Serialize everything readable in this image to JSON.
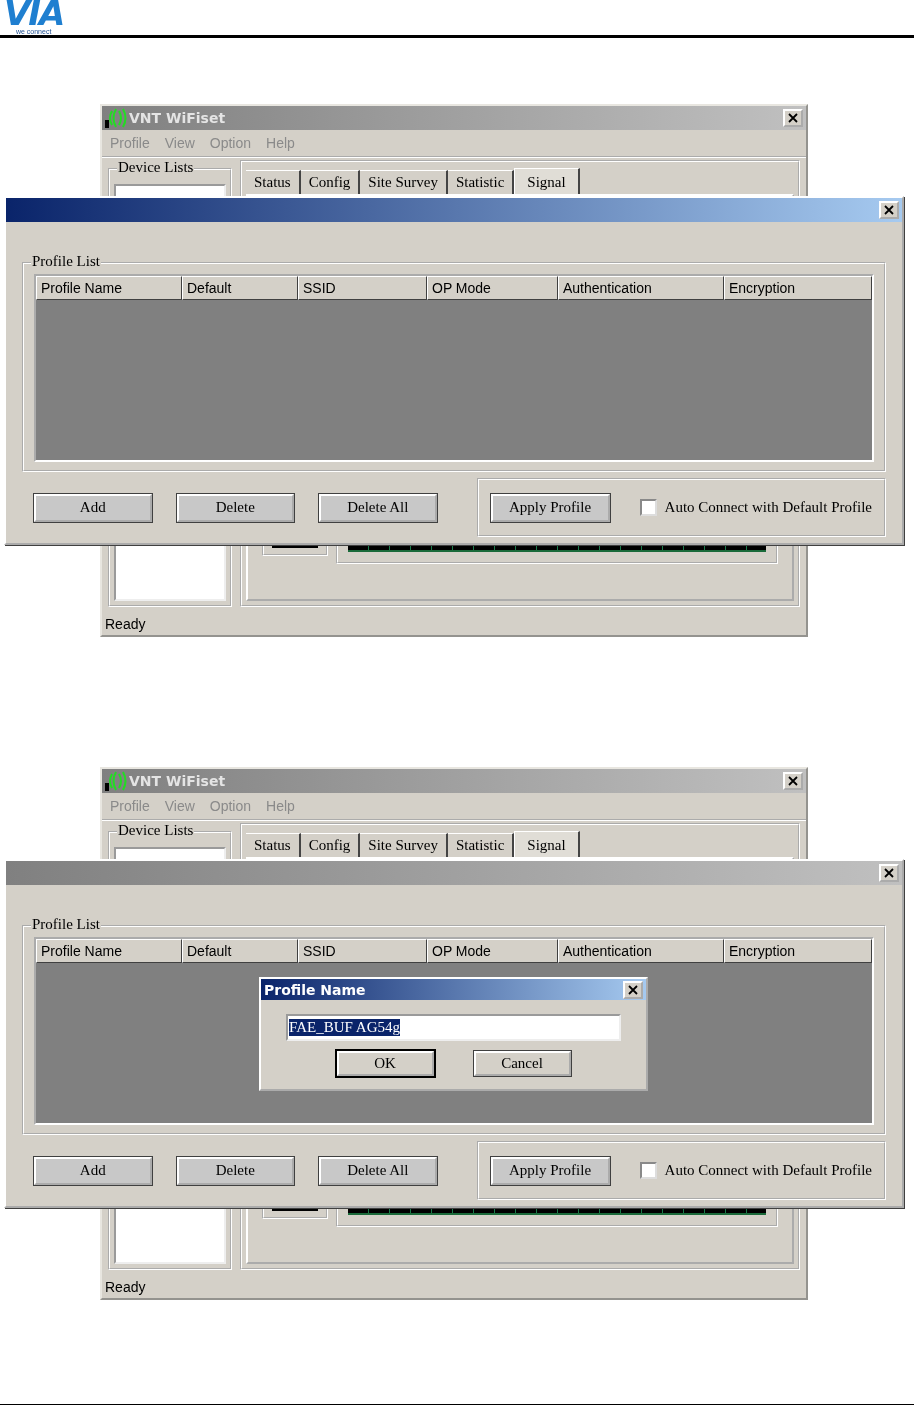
{
  "header": {
    "logo": "VIA",
    "tagline": "we connect"
  },
  "screenshots": [
    {
      "main_window": {
        "title": "VNT WiFiset",
        "menu": [
          {
            "label": "Profile",
            "disabled": true
          },
          {
            "label": "View",
            "disabled": true
          },
          {
            "label": "Option",
            "disabled": true
          },
          {
            "label": "Help",
            "disabled": true
          }
        ],
        "device_lists_label": "Device Lists",
        "tabs": [
          {
            "label": "Status",
            "selected": false
          },
          {
            "label": "Config",
            "selected": false
          },
          {
            "label": "Site Survey",
            "selected": false
          },
          {
            "label": "Statistic",
            "selected": false
          },
          {
            "label": "Signal",
            "selected": true
          }
        ],
        "status": "Ready"
      },
      "dialog": {
        "active": true,
        "group_label": "Profile List",
        "columns": [
          "Profile Name",
          "Default",
          "SSID",
          "OP Mode",
          "Authentication",
          "Encryption"
        ],
        "buttons": [
          "Add",
          "Delete",
          "Delete All"
        ],
        "apply_button": "Apply Profile",
        "auto_connect": {
          "label": "Auto Connect with Default Profile",
          "checked": false
        }
      }
    },
    {
      "main_window": {
        "title": "VNT WiFiset",
        "menu": [
          {
            "label": "Profile",
            "disabled": true
          },
          {
            "label": "View",
            "disabled": true
          },
          {
            "label": "Option",
            "disabled": true
          },
          {
            "label": "Help",
            "disabled": true
          }
        ],
        "device_lists_label": "Device Lists",
        "tabs": [
          {
            "label": "Status",
            "selected": false
          },
          {
            "label": "Config",
            "selected": false
          },
          {
            "label": "Site Survey",
            "selected": false
          },
          {
            "label": "Statistic",
            "selected": false
          },
          {
            "label": "Signal",
            "selected": true
          }
        ],
        "status": "Ready"
      },
      "dialog": {
        "active": false,
        "group_label": "Profile List",
        "columns": [
          "Profile Name",
          "Default",
          "SSID",
          "OP Mode",
          "Authentication",
          "Encryption"
        ],
        "buttons": [
          "Add",
          "Delete",
          "Delete All"
        ],
        "apply_button": "Apply Profile",
        "auto_connect": {
          "label": "Auto Connect with Default Profile",
          "checked": false
        },
        "prompt": {
          "title": "Profile Name",
          "value": "FAE_BUF AG54g",
          "highlighted": true,
          "buttons": [
            "OK",
            "Cancel"
          ]
        }
      }
    }
  ]
}
